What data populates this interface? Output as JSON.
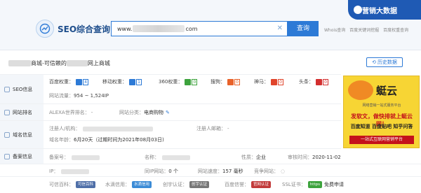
{
  "header": {
    "logo_text": "SEO综合查询",
    "search_prefix": "www.",
    "search_suffix": "com",
    "search_button": "查询",
    "links": [
      "Whois查询",
      "百度关键词挖掘",
      "百度权重查询"
    ],
    "brand": "营销大数据"
  },
  "site": {
    "title_mid": "商城-可信赖的",
    "title_end": "网上商城",
    "history_button": "历史数据"
  },
  "seo": {
    "label": "SEO信息",
    "baidu_label": "百度权重：",
    "baidu_value": "4",
    "mobile_label": "移动权重：",
    "mobile_value": "1",
    "s360_label": "360权重：",
    "s360_value": "0",
    "sogou_label": "搜狗：",
    "sogou_value": "0",
    "shenma_label": "神马：",
    "shenma_value": "0",
    "toutiao_label": "头条：",
    "toutiao_value": "0",
    "traffic_label": "网站流量：",
    "traffic_value": "954 ~ 1,524IP"
  },
  "rank": {
    "label": "网站排名",
    "alexa_label": "ALEXA世界排名：",
    "alexa_value": "-",
    "category_label": "网站分类：",
    "category_value": "电商购物"
  },
  "domain": {
    "label": "域名信息",
    "registrant_label": "注册人/机构：",
    "email_label": "注册人邮箱：",
    "email_value": "-",
    "age_label": "域名年龄：",
    "age_value": "6月20天（过期时间为2021年08月03日)"
  },
  "icp": {
    "label": "备案信息",
    "number_label": "备案号：",
    "name_label": "名称：",
    "nature_label": "性质：",
    "nature_value": "企业",
    "date_label": "审核时间：",
    "date_value": "2020-11-02"
  },
  "server": {
    "ip_label": "IP：",
    "same_ip_label": "同IP网站：",
    "same_ip_value": "0 个",
    "speed_label": "网站速度：",
    "speed_value": "157 毫秒",
    "competitor_label": "竞争网站："
  },
  "certs": {
    "trust_label": "可信百科：",
    "trust_badge": "可信百科",
    "shuidi_label": "水滴信用：",
    "shuidi_badge": "水滴信用",
    "chuangyu_label": "创宇认证：",
    "chuangyu_badge": "创宇认证",
    "baidu_label": "百度信誉：",
    "baidu_badge": "官网认证",
    "ssl_label": "SSL证书：",
    "ssl_badge": "https",
    "ssl_value": "免费申请"
  },
  "ad": {
    "brand": "蜓云",
    "sub": "网络营销一站式服务平台",
    "line1": "发软文，做快排就上蜓云网！",
    "line2": "百度知道  百度贴吧  知乎问答",
    "line3": "一站式互联网营销平台"
  },
  "colors": {
    "accent": "#2d7ad6",
    "baidu": "#2d7ad6",
    "s360": "#3da33d",
    "sogou": "#e8622a",
    "shenma": "#e0442b",
    "toutiao": "#d32f2f"
  }
}
